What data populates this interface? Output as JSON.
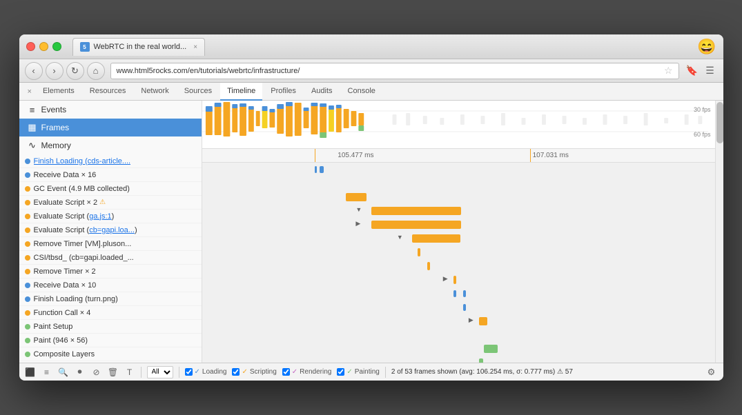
{
  "window": {
    "title": "WebRTC in the real world...",
    "tab_close": "×",
    "emoji": "😄"
  },
  "navbar": {
    "url_prefix": "www.html5rocks.com",
    "url_path": "/en/tutorials/webrtc/infrastructure/"
  },
  "devtools": {
    "tabs": [
      "Elements",
      "Resources",
      "Network",
      "Sources",
      "Timeline",
      "Profiles",
      "Audits",
      "Console"
    ],
    "active_tab": "Timeline",
    "close_btn": "×"
  },
  "sidebar": {
    "items": [
      {
        "id": "events",
        "label": "Events",
        "icon": "≡"
      },
      {
        "id": "frames",
        "label": "Frames",
        "icon": "▦",
        "active": true
      },
      {
        "id": "memory",
        "label": "Memory",
        "icon": "∿"
      }
    ]
  },
  "timeline_entries": [
    {
      "color": "#4a90d9",
      "text": "Finish Loading (cds-article....",
      "link": true
    },
    {
      "color": "#4a90d9",
      "text": "Receive Data × 16"
    },
    {
      "color": "#f5a623",
      "text": "GC Event (4.9 MB collected)"
    },
    {
      "color": "#f5a623",
      "text": "Evaluate Script × 2",
      "warning": true
    },
    {
      "color": "#f5a623",
      "text": "Evaluate Script (ga.js:1)"
    },
    {
      "color": "#f5a623",
      "text": "Evaluate Script (cb=gapi.loa..."
    },
    {
      "color": "#f5a623",
      "text": "Remove Timer [VM].pluson..."
    },
    {
      "color": "#f5a623",
      "text": "CSI/tbsd_ (cb=gapi.loaded_..."
    },
    {
      "color": "#f5a623",
      "text": "Remove Timer × 2"
    },
    {
      "color": "#4a90d9",
      "text": "Receive Data × 10"
    },
    {
      "color": "#4a90d9",
      "text": "Finish Loading (turn.png)"
    },
    {
      "color": "#f5a623",
      "text": "Function Call × 4"
    },
    {
      "color": "#7cc576",
      "text": "Paint Setup"
    },
    {
      "color": "#7cc576",
      "text": "Paint (946 × 56)"
    },
    {
      "color": "#7cc576",
      "text": "Composite Layers"
    }
  ],
  "timeline_markers": {
    "left": "105.477 ms",
    "right": "107.031 ms"
  },
  "fps_labels": {
    "fps30": "30 fps",
    "fps60": "60 fps"
  },
  "status_bar": {
    "filter_label": "All",
    "checkboxes": [
      {
        "label": "Loading",
        "color": "#4a90d9",
        "checked": true
      },
      {
        "label": "Scripting",
        "color": "#f5a623",
        "checked": true
      },
      {
        "label": "Rendering",
        "color": "#c466c1",
        "checked": true
      },
      {
        "label": "Painting",
        "color": "#7cc576",
        "checked": true
      }
    ],
    "summary": "2 of 53 frames shown",
    "avg_text": "(avg: 106.254 ms, σ: 0.777 ms)",
    "frame_count": "57"
  }
}
